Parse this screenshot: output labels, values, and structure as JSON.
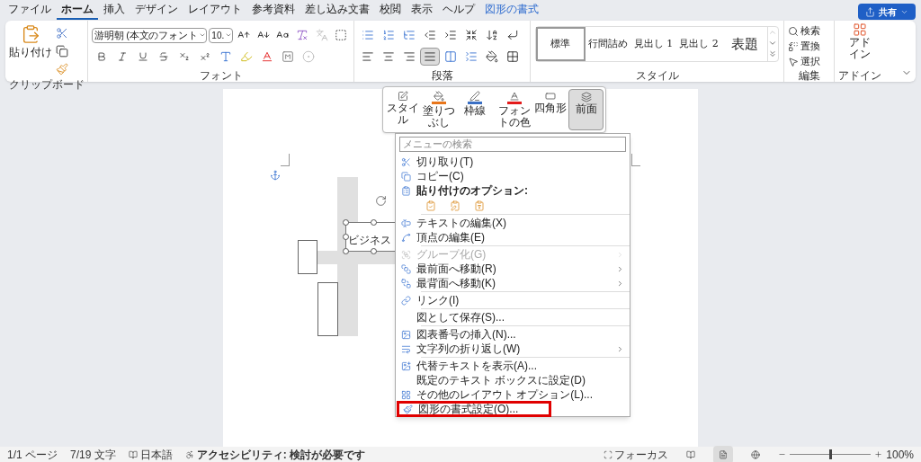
{
  "tabs": [
    {
      "label": "ファイル",
      "selected": false,
      "kind": "normal"
    },
    {
      "label": "ホーム",
      "selected": true,
      "kind": "normal"
    },
    {
      "label": "挿入",
      "selected": false,
      "kind": "normal"
    },
    {
      "label": "デザイン",
      "selected": false,
      "kind": "normal"
    },
    {
      "label": "レイアウト",
      "selected": false,
      "kind": "normal"
    },
    {
      "label": "参考資料",
      "selected": false,
      "kind": "normal"
    },
    {
      "label": "差し込み文書",
      "selected": false,
      "kind": "normal"
    },
    {
      "label": "校閲",
      "selected": false,
      "kind": "normal"
    },
    {
      "label": "表示",
      "selected": false,
      "kind": "normal"
    },
    {
      "label": "ヘルプ",
      "selected": false,
      "kind": "normal"
    },
    {
      "label": "図形の書式",
      "selected": false,
      "kind": "contextual"
    }
  ],
  "share_button": {
    "label": "共有"
  },
  "ribbon": {
    "clipboard": {
      "paste": "貼り付け",
      "label": "クリップボード"
    },
    "font": {
      "font_name": "游明朝 (本文のフォント",
      "font_size": "10.",
      "label": "フォント"
    },
    "paragraph": {
      "align_buttons": [
        {
          "selected": false
        },
        {
          "selected": false
        },
        {
          "selected": false
        },
        {
          "selected": true
        },
        {
          "selected": false
        }
      ],
      "label": "段落"
    },
    "styles": {
      "items": [
        {
          "label": "標準",
          "selected": true
        },
        {
          "label": "行間詰め",
          "selected": false
        },
        {
          "label": "見出し 1",
          "selected": false
        },
        {
          "label": "見出し 2",
          "selected": false
        },
        {
          "label": "表題",
          "selected": false
        }
      ],
      "label": "スタイル"
    },
    "editing": {
      "items": [
        "検索",
        "置換",
        "選択"
      ],
      "label": "編集"
    },
    "addins": {
      "button": "アドイン",
      "label": "アドイン"
    }
  },
  "document": {
    "selected_text": "ビジネス"
  },
  "mini_toolbar": [
    {
      "label": "スタイル",
      "selected": false
    },
    {
      "label": "塗りつぶし",
      "selected": false
    },
    {
      "label": "枠線",
      "selected": false
    },
    {
      "label": "フォントの色",
      "selected": false
    },
    {
      "label": "四角形",
      "selected": false
    },
    {
      "label": "前面",
      "selected": true
    }
  ],
  "context_menu": {
    "search_placeholder": "メニューの検索",
    "items": [
      {
        "kind": "item",
        "label": "切り取り(T)",
        "disabled": false,
        "submenu": false,
        "highlighted": false
      },
      {
        "kind": "item",
        "label": "コピー(C)",
        "disabled": false,
        "submenu": false,
        "highlighted": false
      },
      {
        "kind": "header",
        "label": "貼り付けのオプション:"
      },
      {
        "kind": "paste_options"
      },
      {
        "kind": "separator"
      },
      {
        "kind": "item",
        "label": "テキストの編集(X)",
        "disabled": false,
        "submenu": false,
        "highlighted": false
      },
      {
        "kind": "item",
        "label": "頂点の編集(E)",
        "disabled": false,
        "submenu": false,
        "highlighted": false
      },
      {
        "kind": "separator"
      },
      {
        "kind": "item",
        "label": "グループ化(G)",
        "disabled": true,
        "submenu": true,
        "highlighted": false
      },
      {
        "kind": "item",
        "label": "最前面へ移動(R)",
        "disabled": false,
        "submenu": true,
        "highlighted": false
      },
      {
        "kind": "item",
        "label": "最背面へ移動(K)",
        "disabled": false,
        "submenu": true,
        "highlighted": false
      },
      {
        "kind": "separator"
      },
      {
        "kind": "item",
        "label": "リンク(I)",
        "disabled": false,
        "submenu": false,
        "highlighted": false
      },
      {
        "kind": "separator"
      },
      {
        "kind": "item",
        "label": "図として保存(S)...",
        "disabled": false,
        "submenu": false,
        "highlighted": false
      },
      {
        "kind": "separator"
      },
      {
        "kind": "item",
        "label": "図表番号の挿入(N)...",
        "disabled": false,
        "submenu": false,
        "highlighted": false
      },
      {
        "kind": "item",
        "label": "文字列の折り返し(W)",
        "disabled": false,
        "submenu": true,
        "highlighted": false
      },
      {
        "kind": "separator"
      },
      {
        "kind": "item",
        "label": "代替テキストを表示(A)...",
        "disabled": false,
        "submenu": false,
        "highlighted": false
      },
      {
        "kind": "item",
        "label": "既定のテキスト ボックスに設定(D)",
        "disabled": false,
        "submenu": false,
        "highlighted": false
      },
      {
        "kind": "item",
        "label": "その他のレイアウト オプション(L)...",
        "disabled": false,
        "submenu": false,
        "highlighted": false
      },
      {
        "kind": "item",
        "label": "図形の書式設定(O)...",
        "disabled": false,
        "submenu": false,
        "highlighted": true
      }
    ]
  },
  "status_bar": {
    "left": [
      "1/1 ページ",
      "7/19 文字",
      "日本語"
    ],
    "accessibility": "アクセシビリティ: 検討が必要です",
    "focus": "フォーカス",
    "zoom": {
      "level": 0.5,
      "reading": "100%"
    }
  }
}
